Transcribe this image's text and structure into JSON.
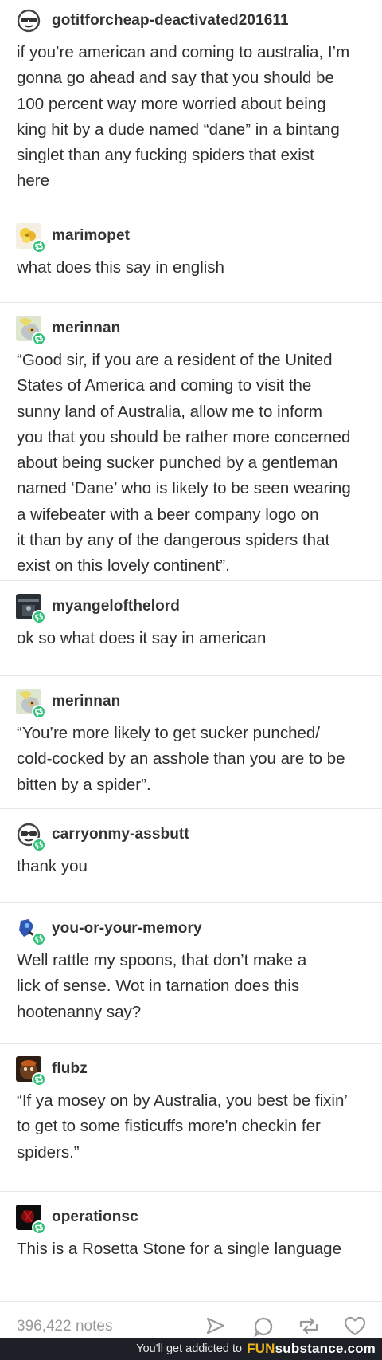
{
  "posts": [
    {
      "username": "gotitforcheap-deactivated201611",
      "avatar_icon": "sunglasses-face-icon",
      "reblog": false,
      "lines": [
        "if you’re american and coming to australia, I’m",
        "gonna go ahead and say that you should be",
        "100 percent way more worried about being",
        "king hit by a dude named “dane” in a bintang",
        "singlet than any fucking spiders that exist",
        "here"
      ]
    },
    {
      "username": "marimopet",
      "avatar_icon": "yellow-flower-avatar-icon",
      "reblog": true,
      "lines": [
        "what does this say in english"
      ]
    },
    {
      "username": "merinnan",
      "avatar_icon": "pony-avatar-icon",
      "reblog": true,
      "lines": [
        "“Good sir, if you are a resident of the United",
        "States of America and coming to visit the",
        "sunny land of Australia, allow me to inform",
        "you that you should be rather more concerned",
        "about being sucker punched by a gentleman",
        "named ‘Dane’ who is likely to be seen wearing",
        "a wifebeater with a beer company logo on",
        "it than by any of the dangerous spiders that",
        "exist on this lovely continent”."
      ]
    },
    {
      "username": "myangelofthelord",
      "avatar_icon": "dark-photo-avatar-icon",
      "reblog": true,
      "lines": [
        "ok so what does it say in american"
      ]
    },
    {
      "username": "merinnan",
      "avatar_icon": "pony-avatar-icon",
      "reblog": true,
      "lines": [
        "“You’re more likely to get sucker punched/",
        "cold-cocked by an asshole than you are to be",
        "bitten by a spider”."
      ]
    },
    {
      "username": "carryonmy-assbutt",
      "avatar_icon": "sunglasses-face-icon",
      "reblog": true,
      "lines": [
        "thank you"
      ]
    },
    {
      "username": "you-or-your-memory",
      "avatar_icon": "blue-character-avatar-icon",
      "reblog": true,
      "lines": [
        "Well rattle my spoons, that don’t make a",
        "lick of sense. Wot in tarnation does this",
        "hootenanny say?"
      ]
    },
    {
      "username": "flubz",
      "avatar_icon": "brown-character-avatar-icon",
      "reblog": true,
      "lines": [
        "“If ya mosey on by Australia, you best be fixin’",
        "to get to some fisticuffs more'n checkin fer",
        "spiders.”"
      ]
    },
    {
      "username": "operationsc",
      "avatar_icon": "red-dark-avatar-icon",
      "reblog": true,
      "lines": [
        "This is a Rosetta Stone for a single language"
      ]
    }
  ],
  "footer": {
    "notes": "396,422 notes",
    "actions": [
      "share-icon",
      "reply-icon",
      "reblog-icon",
      "like-icon"
    ]
  },
  "banner": {
    "tagline": "You'll get addicted to",
    "brand_fun": "FUN",
    "brand_rest": "substance",
    "brand_suffix": ".com"
  },
  "colors": {
    "reblog_badge": "#2fc177",
    "banner_bg": "#1d2027",
    "brand_accent": "#f1b51c",
    "text": "#2e2e2e",
    "muted": "#9a9a9a"
  }
}
